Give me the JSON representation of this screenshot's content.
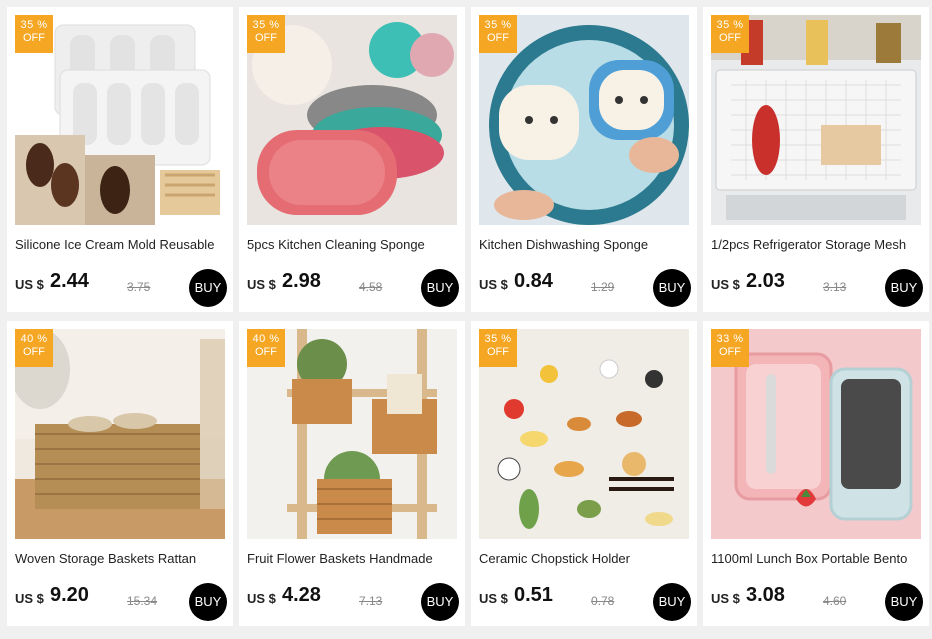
{
  "products": [
    {
      "title": "Silicone Ice Cream Mold Reusable",
      "discount": "35 %",
      "off": "OFF",
      "currency": "US $",
      "price": "2.44",
      "original": "3.75",
      "buy": "BUY",
      "image": "ice-cream-mold-image"
    },
    {
      "title": "5pcs Kitchen Cleaning Sponge",
      "discount": "35 %",
      "off": "OFF",
      "currency": "US $",
      "price": "2.98",
      "original": "4.58",
      "buy": "BUY",
      "image": "cleaning-sponge-image"
    },
    {
      "title": "Kitchen Dishwashing Sponge",
      "discount": "35 %",
      "off": "OFF",
      "currency": "US $",
      "price": "0.84",
      "original": "1.29",
      "buy": "BUY",
      "image": "cat-sponge-image"
    },
    {
      "title": "1/2pcs Refrigerator Storage Mesh",
      "discount": "35 %",
      "off": "OFF",
      "currency": "US $",
      "price": "2.03",
      "original": "3.13",
      "buy": "BUY",
      "image": "fridge-mesh-image"
    },
    {
      "title": "Woven Storage Baskets Rattan",
      "discount": "40 %",
      "off": "OFF",
      "currency": "US $",
      "price": "9.20",
      "original": "15.34",
      "buy": "BUY",
      "image": "rattan-basket-image"
    },
    {
      "title": "Fruit Flower Baskets Handmade",
      "discount": "40 %",
      "off": "OFF",
      "currency": "US $",
      "price": "4.28",
      "original": "7.13",
      "buy": "BUY",
      "image": "hanging-basket-image"
    },
    {
      "title": "Ceramic Chopstick Holder",
      "discount": "35 %",
      "off": "OFF",
      "currency": "US $",
      "price": "0.51",
      "original": "0.78",
      "buy": "BUY",
      "image": "chopstick-holder-image"
    },
    {
      "title": "1100ml Lunch Box Portable Bento",
      "discount": "33 %",
      "off": "OFF",
      "currency": "US $",
      "price": "3.08",
      "original": "4.60",
      "buy": "BUY",
      "image": "lunch-box-image"
    }
  ],
  "colors": {
    "badge": "#f5a623",
    "buy_button": "#000000",
    "background": "#f0f0f0"
  }
}
